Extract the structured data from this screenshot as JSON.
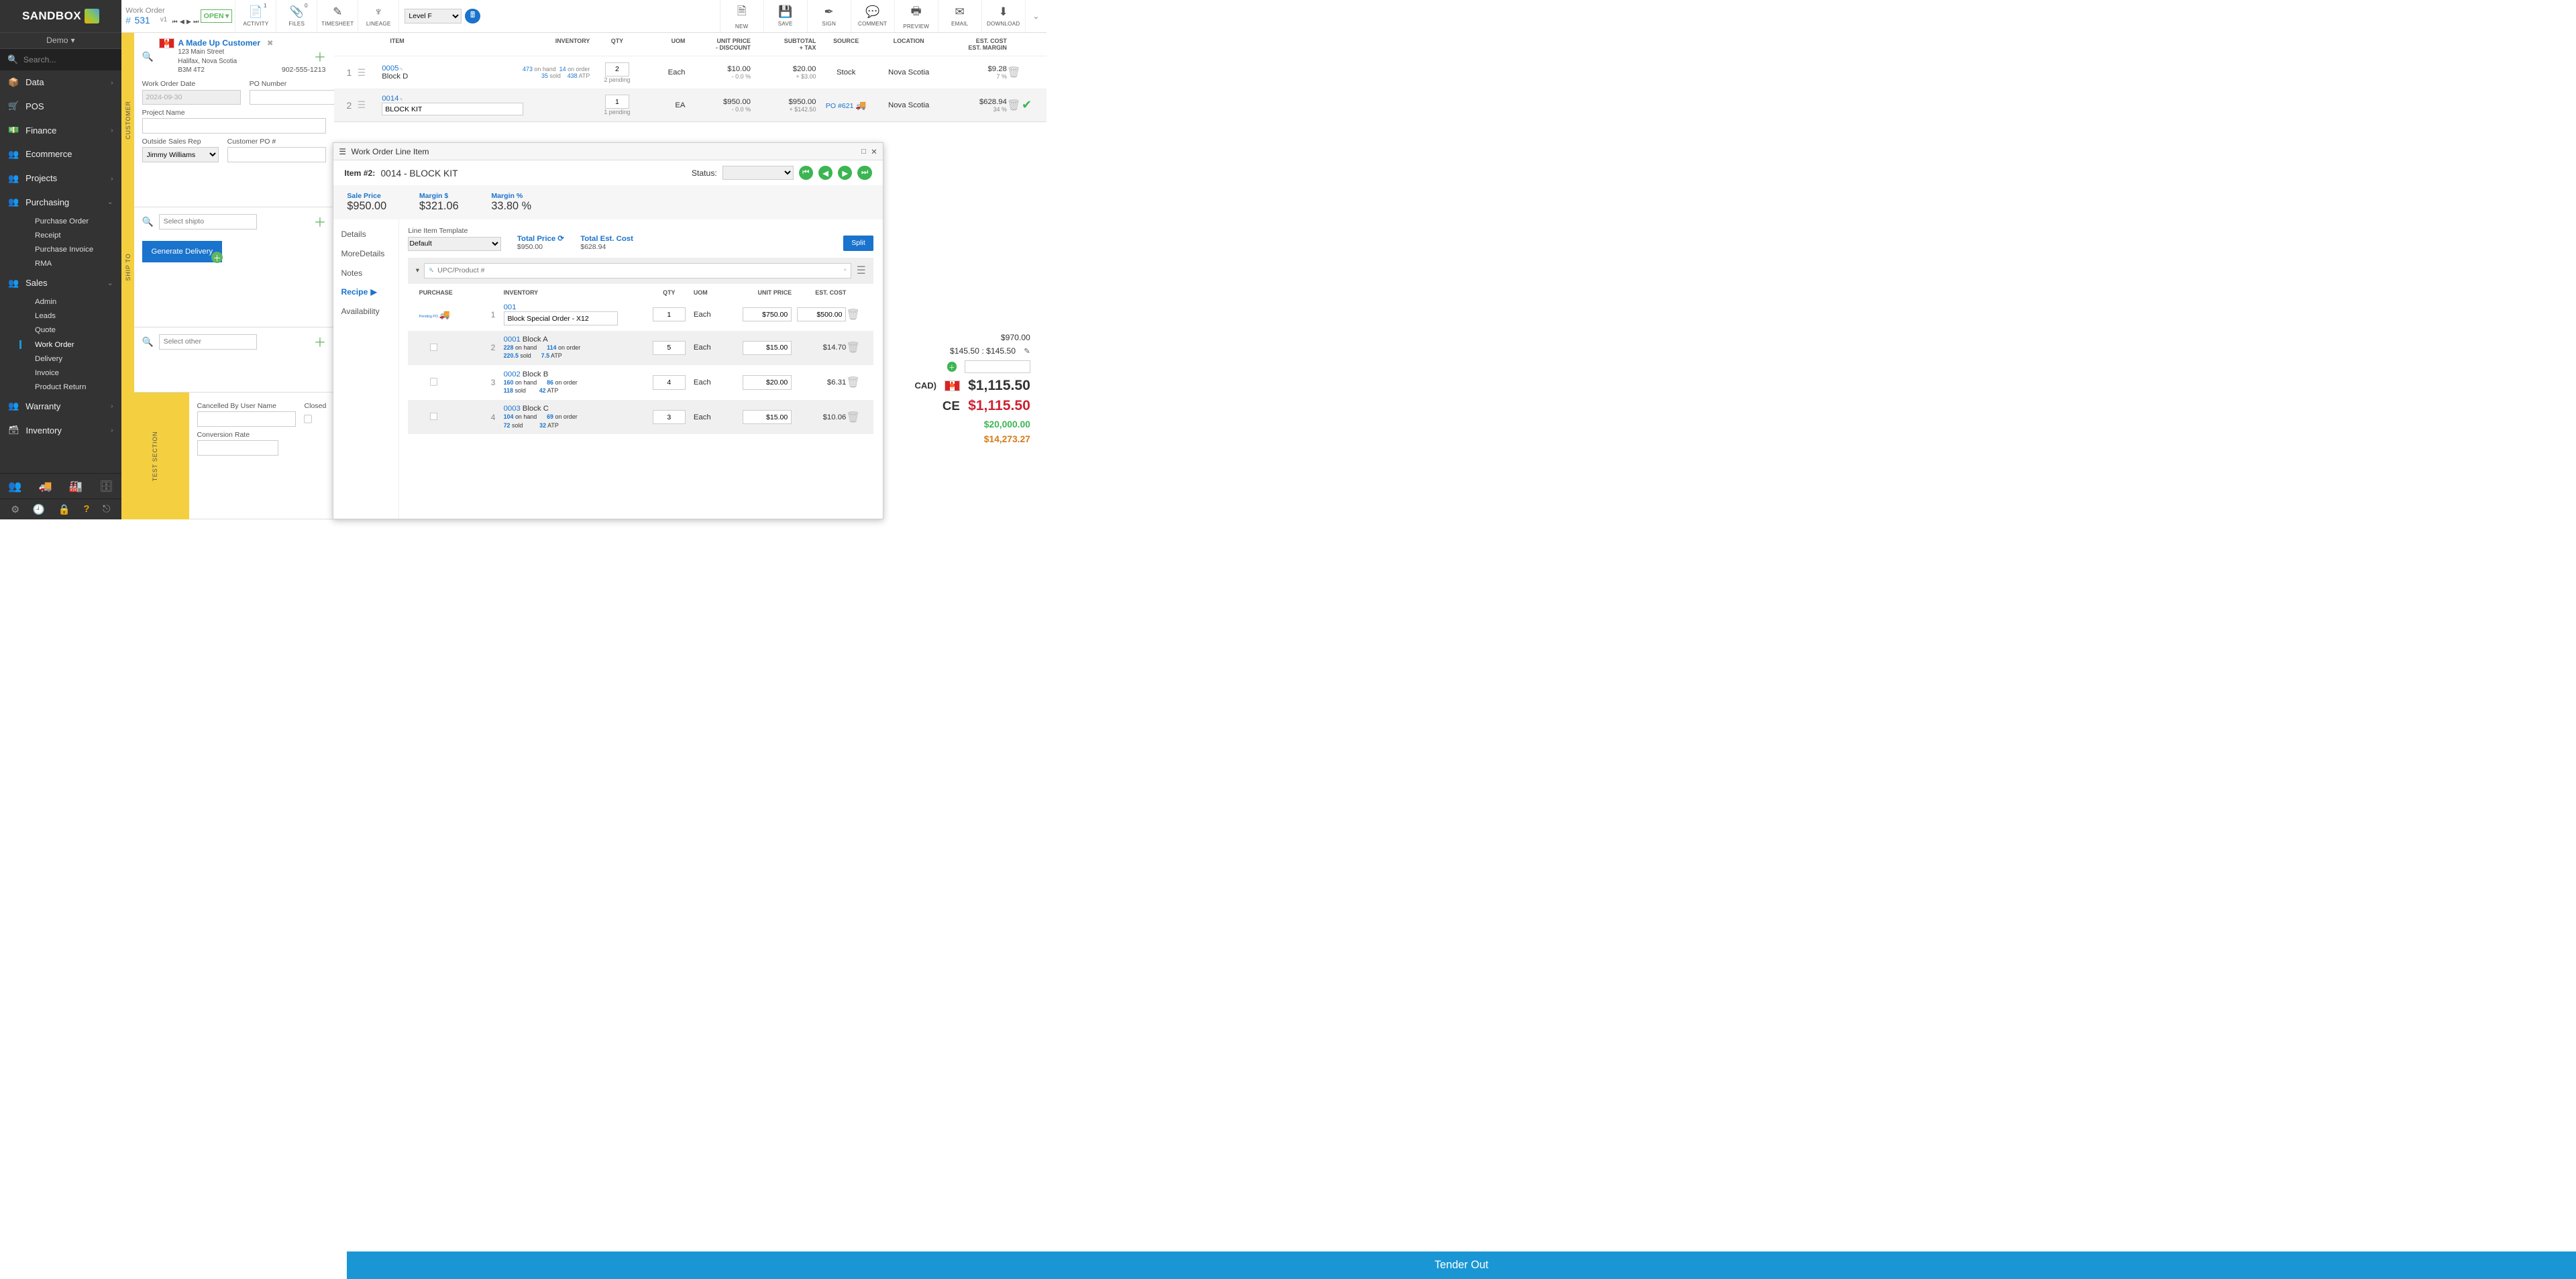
{
  "brand": "SANDBOX",
  "tenant": "Demo",
  "search_placeholder": "Search...",
  "nav": {
    "data": "Data",
    "pos": "POS",
    "finance": "Finance",
    "ecommerce": "Ecommerce",
    "projects": "Projects",
    "purchasing": "Purchasing",
    "sales": "Sales",
    "warranty": "Warranty",
    "inventory": "Inventory",
    "purchasing_sub": [
      "Purchase Order",
      "Receipt",
      "Purchase Invoice",
      "RMA"
    ],
    "sales_sub": [
      "Admin",
      "Leads",
      "Quote",
      "Work Order",
      "Delivery",
      "Invoice",
      "Product Return"
    ]
  },
  "doc": {
    "type": "Work Order",
    "hash": "# ",
    "num": "531",
    "ver": "v1",
    "status": "OPEN"
  },
  "toolbar": {
    "activity": "ACTIVITY",
    "activity_n": "1",
    "files": "FILES",
    "files_n": "0",
    "timesheet": "TIMESHEET",
    "lineage": "LINEAGE",
    "price_level": "Level F",
    "new": "NEW",
    "save": "SAVE",
    "sign": "SIGN",
    "comment": "COMMENT",
    "preview": "PREVIEW",
    "email": "EMAIL",
    "download": "DOWNLOAD"
  },
  "customer": {
    "name": "A Made Up Customer",
    "addr1": "123 Main Street",
    "addr2": "Halifax, Nova Scotia",
    "addr3": "B3M 4T2",
    "phone": "902-555-1213",
    "wo_date_label": "Work Order Date",
    "wo_date": "2024-09-30",
    "po_label": "PO Number",
    "project_label": "Project Name",
    "osr_label": "Outside Sales Rep",
    "osr": "Jimmy Williams",
    "cpo_label": "Customer PO #",
    "gen_delivery": "Generate Delivery"
  },
  "shipto_placeholder": "Select shipto",
  "other_placeholder": "Select other",
  "test": {
    "cancelled_label": "Cancelled By User Name",
    "closed_label": "Closed",
    "conv_label": "Conversion Rate"
  },
  "gutters": {
    "customer": "CUSTOMER",
    "shipto": "SHIP TO",
    "test": "TEST SECTION"
  },
  "table": {
    "headers": {
      "item": "ITEM",
      "inv": "INVENTORY",
      "qty": "QTY",
      "uom": "UOM",
      "up1": "UNIT PRICE",
      "up2": "- DISCOUNT",
      "sub1": "SUBTOTAL",
      "sub2": "+ TAX",
      "src": "SOURCE",
      "loc": "LOCATION",
      "est1": "EST. COST",
      "est2": "EST. MARGIN"
    },
    "rows": [
      {
        "n": "1",
        "code": "0005",
        "desc": "Block D",
        "onhand": "473",
        "onhand_l": "on hand",
        "sold": "35",
        "sold_l": "sold",
        "onorder": "14",
        "onorder_l": "on order",
        "atp": "438",
        "atp_l": "ATP",
        "qty": "2",
        "pending": "2 pending",
        "uom": "Each",
        "up": "$10.00",
        "disc": "- 0.0 %",
        "sub": "$20.00",
        "tax": "+ $3.00",
        "src": "Stock",
        "loc": "Nova Scotia",
        "est": "$9.28",
        "margin": "7 %"
      },
      {
        "n": "2",
        "code": "0014",
        "desc": "BLOCK KIT",
        "onhand": "",
        "onhand_l": "",
        "sold": "",
        "sold_l": "",
        "onorder": "",
        "onorder_l": "",
        "atp": "",
        "atp_l": "",
        "qty": "1",
        "pending": "1 pending",
        "uom": "EA",
        "up": "$950.00",
        "disc": "- 0.0 %",
        "sub": "$950.00",
        "tax": "+ $142.50",
        "src": "PO #621",
        "loc": "Nova Scotia",
        "est": "$628.94",
        "margin": "34 %"
      }
    ]
  },
  "totals": {
    "subtotal": "$970.00",
    "tax_line": "$145.50 : $145.50",
    "cad": "CAD)",
    "grand": "$1,115.50",
    "balance_lbl": "CE",
    "balance": "$1,115.50",
    "goal": "$20,000.00",
    "progress": "$14,273.27"
  },
  "tender": "Tender Out",
  "modal": {
    "title": "Work Order Line Item",
    "item_lbl": "Item #2:",
    "item_name": "0014 - BLOCK KIT",
    "status_lbl": "Status:",
    "stats": {
      "sp_l": "Sale Price",
      "sp": "$950.00",
      "md_l": "Margin $",
      "md": "$321.06",
      "mp_l": "Margin %",
      "mp": "33.80 %"
    },
    "tabs": {
      "details": "Details",
      "more": "MoreDetails",
      "notes": "Notes",
      "recipe": "Recipe",
      "avail": "Availability"
    },
    "tmpl_label": "Line Item Template",
    "tmpl": "Default",
    "tp_label": "Total Price",
    "tp": "$950.00",
    "tec_label": "Total Est. Cost",
    "tec": "$628.94",
    "split": "Split",
    "search_placeholder": "UPC/Product #",
    "rheaders": {
      "pur": "PURCHASE",
      "inv": "INVENTORY",
      "qty": "QTY",
      "uom": "UOM",
      "up": "UNIT PRICE",
      "est": "EST. COST"
    },
    "pending": "Pending PO",
    "rows": [
      {
        "n": "1",
        "code": "001",
        "desc": "Block Special Order - X12",
        "qty": "1",
        "uom": "Each",
        "up": "$750.00",
        "est": "$500.00"
      },
      {
        "n": "2",
        "code": "0001",
        "name": "Block A",
        "oh": "228",
        "oh_l": "on hand",
        "sold": "220.5",
        "sold_l": "sold",
        "oo": "114",
        "oo_l": "on order",
        "atp": "7.5",
        "atp_l": "ATP",
        "qty": "5",
        "uom": "Each",
        "up": "$15.00",
        "est": "$14.70"
      },
      {
        "n": "3",
        "code": "0002",
        "name": "Block B",
        "oh": "160",
        "oh_l": "on hand",
        "sold": "118",
        "sold_l": "sold",
        "oo": "86",
        "oo_l": "on order",
        "atp": "42",
        "atp_l": "ATP",
        "qty": "4",
        "uom": "Each",
        "up": "$20.00",
        "est": "$6.31"
      },
      {
        "n": "4",
        "code": "0003",
        "name": "Block C",
        "oh": "104",
        "oh_l": "on hand",
        "sold": "72",
        "sold_l": "sold",
        "oo": "69",
        "oo_l": "on order",
        "atp": "32",
        "atp_l": "ATP",
        "qty": "3",
        "uom": "Each",
        "up": "$15.00",
        "est": "$10.06"
      }
    ]
  }
}
